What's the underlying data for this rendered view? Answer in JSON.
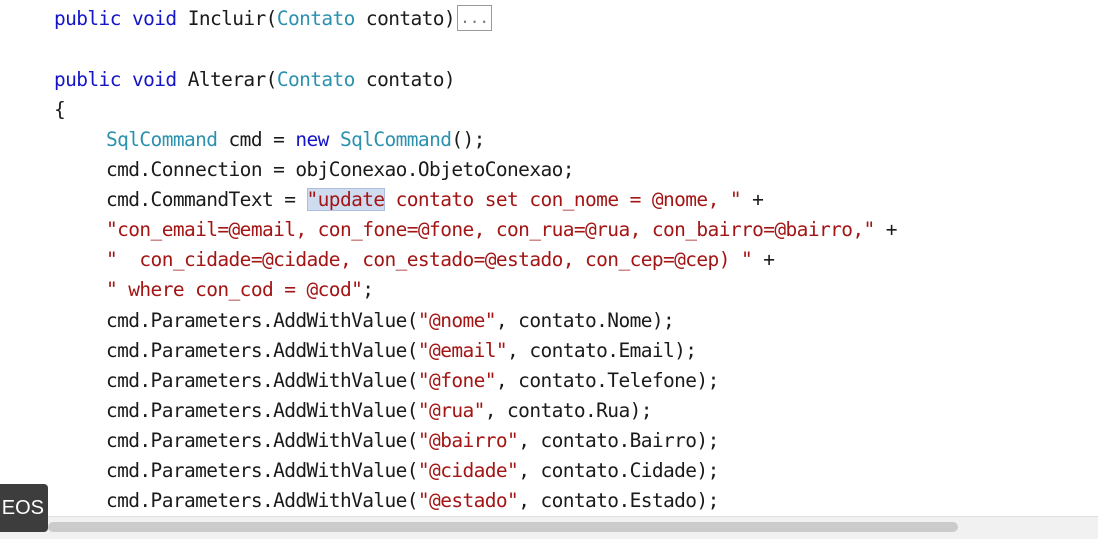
{
  "code": {
    "l1": {
      "kw1": "public",
      "kw2": "void",
      "name": "Incluir(",
      "type": "Contato",
      "param": " contato)",
      "collapsed": "..."
    },
    "l2": {
      "kw1": "public",
      "kw2": "void",
      "name": "Alterar(",
      "type": "Contato",
      "param": " contato)"
    },
    "l3": {
      "text": "{"
    },
    "l4": {
      "type1": "SqlCommand",
      "mid": " cmd = ",
      "kw": "new",
      "type2": "SqlCommand",
      "tail": "();"
    },
    "l5": {
      "text": "cmd.Connection = objConexao.ObjetoConexao;"
    },
    "l6": {
      "pre": "cmd.CommandText = ",
      "sel": "\"update",
      "rest": " contato set con_nome = @nome, \"",
      "tail": " +"
    },
    "l7": {
      "str": "\"con_email=@email, con_fone=@fone, con_rua=@rua, con_bairro=@bairro,\"",
      "tail": " +"
    },
    "l8": {
      "str": "\"  con_cidade=@cidade, con_estado=@estado, con_cep=@cep) \"",
      "tail": " +"
    },
    "l9": {
      "str": "\" where con_cod = @cod\"",
      "tail": ";"
    },
    "params": [
      {
        "pre": "cmd.Parameters.AddWithValue(",
        "str": "\"@nome\"",
        "post": ", contato.Nome);"
      },
      {
        "pre": "cmd.Parameters.AddWithValue(",
        "str": "\"@email\"",
        "post": ", contato.Email);"
      },
      {
        "pre": "cmd.Parameters.AddWithValue(",
        "str": "\"@fone\"",
        "post": ", contato.Telefone);"
      },
      {
        "pre": "cmd.Parameters.AddWithValue(",
        "str": "\"@rua\"",
        "post": ", contato.Rua);"
      },
      {
        "pre": "cmd.Parameters.AddWithValue(",
        "str": "\"@bairro\"",
        "post": ", contato.Bairro);"
      },
      {
        "pre": "cmd.Parameters.AddWithValue(",
        "str": "\"@cidade\"",
        "post": ", contato.Cidade);"
      },
      {
        "pre": "cmd.Parameters.AddWithValue(",
        "str": "\"@estado\"",
        "post": ", contato.Estado);"
      }
    ]
  },
  "overlay": {
    "label": "EOS"
  },
  "colors": {
    "keyword": "#1515c8",
    "type": "#2b91af",
    "string": "#a31515",
    "plain": "#1a1a1a",
    "selection": "#cfdcf0"
  }
}
